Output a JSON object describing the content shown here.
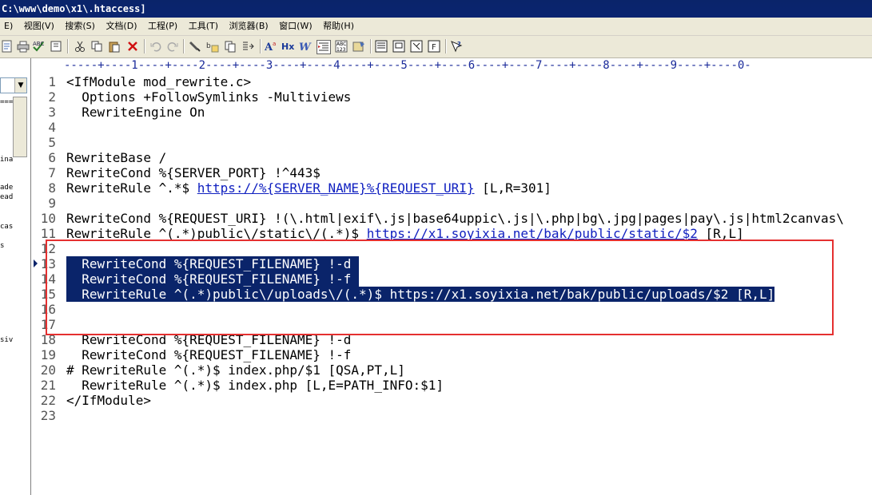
{
  "window": {
    "title": "C:\\www\\demo\\x1\\.htaccess]"
  },
  "menu": [
    "E)",
    "视图(V)",
    "搜索(S)",
    "文档(D)",
    "工程(P)",
    "工具(T)",
    "浏览器(B)",
    "窗口(W)",
    "帮助(H)"
  ],
  "toolbar_icons": [
    "new-icon",
    "print-icon",
    "spellcheck-icon",
    "doc-icon",
    "cut-icon",
    "copy-icon",
    "paste-icon",
    "delete-icon",
    "undo-icon",
    "redo-icon",
    "find-icon",
    "replace-icon",
    "find-files-icon",
    "goto-icon",
    "font-size-icon",
    "hex-icon",
    "word-wrap-icon",
    "indent-icon",
    "column-mode-icon",
    "settings-icon",
    "window1-icon",
    "window2-icon",
    "window3-icon",
    "window4-icon",
    "help-icon"
  ],
  "ruler": "-----+----1----+----2----+----3----+----4----+----5----+----6----+----7----+----8----+----9----+----0-",
  "left_fragments": [
    "===",
    "ina",
    "ade",
    "ead",
    "cas",
    "s",
    "siv"
  ],
  "lines": [
    {
      "n": "1",
      "text": "<IfModule mod_rewrite.c>"
    },
    {
      "n": "2",
      "text": "  Options +FollowSymlinks -Multiviews"
    },
    {
      "n": "3",
      "text": "  RewriteEngine On"
    },
    {
      "n": "4",
      "text": ""
    },
    {
      "n": "5",
      "text": ""
    },
    {
      "n": "6",
      "text": "RewriteBase /"
    },
    {
      "n": "7",
      "text": "RewriteCond %{SERVER_PORT} !^443$"
    },
    {
      "n": "8",
      "pre": "RewriteRule ^.*$ ",
      "link": "https://%{SERVER_NAME}%{REQUEST_URI}",
      "post": " [L,R=301]"
    },
    {
      "n": "9",
      "text": ""
    },
    {
      "n": "10",
      "text": "RewriteCond %{REQUEST_URI} !(\\.html|exif\\.js|base64uppic\\.js|\\.php|bg\\.jpg|pages|pay\\.js|html2canvas\\"
    },
    {
      "n": "11",
      "pre": "RewriteRule ^(.*)public\\/static\\/(.*)$ ",
      "link": "https://x1.soyixia.net/bak/public/static/$2",
      "post": " [R,L]"
    },
    {
      "n": "12",
      "text": ""
    },
    {
      "n": "13",
      "text": "  RewriteCond %{REQUEST_FILENAME} !-d ",
      "selected": true
    },
    {
      "n": "14",
      "text": "  RewriteCond %{REQUEST_FILENAME} !-f ",
      "selected": true
    },
    {
      "n": "15",
      "text": "  RewriteRule ^(.*)public\\/uploads\\/(.*)$ https://x1.soyixia.net/bak/public/uploads/$2 [R,L]",
      "selected": true
    },
    {
      "n": "16",
      "text": ""
    },
    {
      "n": "17",
      "text": ""
    },
    {
      "n": "18",
      "text": "  RewriteCond %{REQUEST_FILENAME} !-d"
    },
    {
      "n": "19",
      "text": "  RewriteCond %{REQUEST_FILENAME} !-f"
    },
    {
      "n": "20",
      "text": "# RewriteRule ^(.*)$ index.php/$1 [QSA,PT,L]"
    },
    {
      "n": "21",
      "text": "  RewriteRule ^(.*)$ index.php [L,E=PATH_INFO:$1]"
    },
    {
      "n": "22",
      "text": "</IfModule>"
    },
    {
      "n": "23",
      "text": ""
    }
  ],
  "colors": {
    "selection": "#0a246a",
    "highlight_box": "#e53030",
    "link": "#1020c0"
  }
}
